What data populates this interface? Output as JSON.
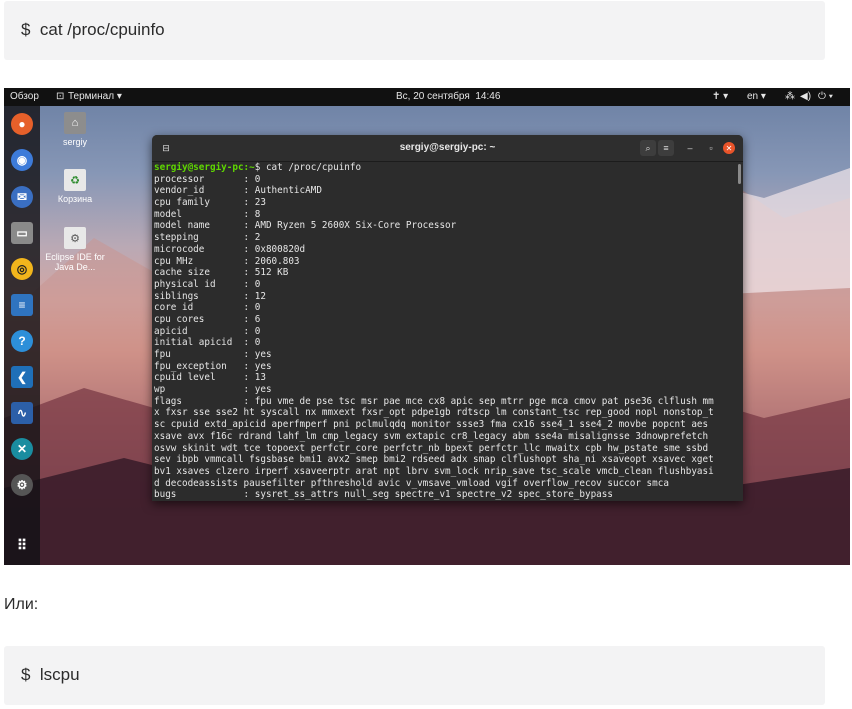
{
  "code_blocks": [
    {
      "text": "$  cat /proc/cpuinfo"
    },
    {
      "text": "$  lscpu"
    }
  ],
  "between_text": "Или:",
  "screenshot": {
    "topbar": {
      "activities": "Обзор",
      "app_menu": "Терминал ▾",
      "clock": "Вс, 20 сентября  14:46",
      "lang": "en ▾"
    },
    "desktop_icons": [
      {
        "label": "sergiy",
        "icon": "home-folder-icon"
      },
      {
        "label": "Корзина",
        "icon": "trash-icon"
      },
      {
        "label": "Eclipse IDE for Java De...",
        "icon": "eclipse-icon"
      }
    ],
    "dock_icons": [
      "firefox-icon",
      "chromium-icon",
      "thunderbird-icon",
      "files-icon",
      "rhythmbox-icon",
      "writer-icon",
      "help-icon",
      "vscode-icon",
      "system-monitor-icon",
      "app-icon",
      "settings-icon",
      "show-apps-icon"
    ],
    "terminal": {
      "title": "sergiy@sergiy-pc: ~",
      "prompt": "sergiy@sergiy-pc:~",
      "command": "$ cat /proc/cpuinfo",
      "lines": [
        "processor       : 0",
        "vendor_id       : AuthenticAMD",
        "cpu family      : 23",
        "model           : 8",
        "model name      : AMD Ryzen 5 2600X Six-Core Processor",
        "stepping        : 2",
        "microcode       : 0x800820d",
        "cpu MHz         : 2060.803",
        "cache size      : 512 KB",
        "physical id     : 0",
        "siblings        : 12",
        "core id         : 0",
        "cpu cores       : 6",
        "apicid          : 0",
        "initial apicid  : 0",
        "fpu             : yes",
        "fpu_exception   : yes",
        "cpuid level     : 13",
        "wp              : yes",
        "flags           : fpu vme de pse tsc msr pae mce cx8 apic sep mtrr pge mca cmov pat pse36 clflush mm",
        "x fxsr sse sse2 ht syscall nx mmxext fxsr_opt pdpe1gb rdtscp lm constant_tsc rep_good nopl nonstop_t",
        "sc cpuid extd_apicid aperfmperf pni pclmulqdq monitor ssse3 fma cx16 sse4_1 sse4_2 movbe popcnt aes",
        "xsave avx f16c rdrand lahf_lm cmp_legacy svm extapic cr8_legacy abm sse4a misalignsse 3dnowprefetch",
        "osvw skinit wdt tce topoext perfctr_core perfctr_nb bpext perfctr_llc mwaitx cpb hw_pstate sme ssbd",
        "sev ibpb vmmcall fsgsbase bmi1 avx2 smep bmi2 rdseed adx smap clflushopt sha_ni xsaveopt xsavec xget",
        "bv1 xsaves clzero irperf xsaveerptr arat npt lbrv svm_lock nrip_save tsc_scale vmcb_clean flushbyasi",
        "d decodeassists pausefilter pfthreshold avic v_vmsave_vmload vgif overflow_recov succor smca",
        "bugs            : sysret_ss_attrs null_seg spectre_v1 spectre_v2 spec_store_bypass"
      ]
    }
  }
}
